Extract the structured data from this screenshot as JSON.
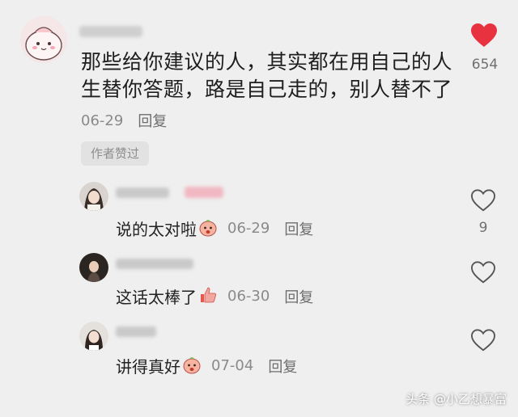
{
  "main_comment": {
    "text": "那些给你建议的人，其实都在用自己的人生替你答题，路是自己走的，别人替不了",
    "date": "06-29",
    "reply_label": "回复",
    "author_liked_badge": "作者赞过",
    "like_count": "654",
    "liked": true
  },
  "replies": [
    {
      "text": "说的太对啦",
      "emoji": "peach-face-emoji",
      "date": "06-29",
      "reply_label": "回复",
      "like_count": "9"
    },
    {
      "text": "这话太棒了",
      "emoji": "thumbs-up-emoji",
      "date": "06-30",
      "reply_label": "回复",
      "like_count": ""
    },
    {
      "text": "讲得真好",
      "emoji": "peach-face-emoji",
      "date": "07-04",
      "reply_label": "回复",
      "like_count": ""
    }
  ],
  "watermark": "头条 @小乙想暴富",
  "colors": {
    "heart_red": "#e8323f",
    "background": "#efefef"
  }
}
